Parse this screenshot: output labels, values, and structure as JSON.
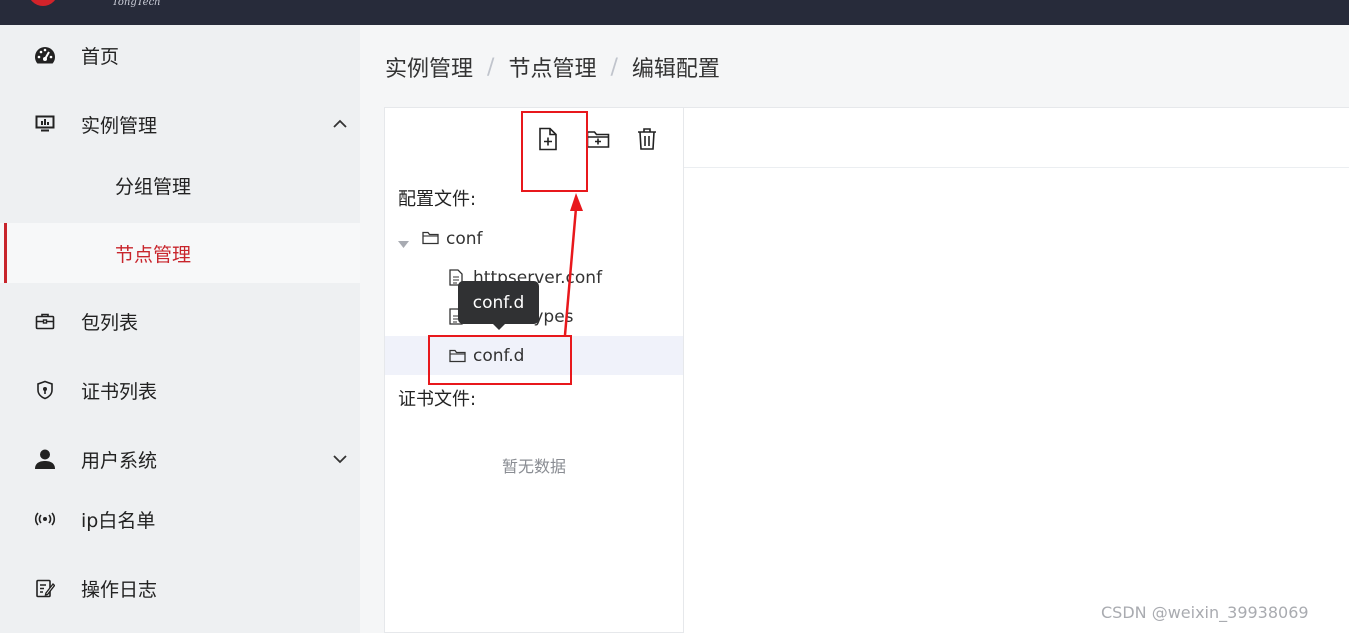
{
  "header": {
    "logo_text": "TongTech",
    "brand_color": "#d2232a"
  },
  "sidebar": {
    "items": [
      {
        "label": "首页",
        "icon": "dashboard-icon"
      },
      {
        "label": "实例管理",
        "icon": "monitor-icon",
        "expanded": true
      },
      {
        "label": "分组管理"
      },
      {
        "label": "节点管理",
        "active": true
      },
      {
        "label": "包列表",
        "icon": "briefcase-icon"
      },
      {
        "label": "证书列表",
        "icon": "shield-icon"
      },
      {
        "label": "用户系统",
        "icon": "user-icon",
        "expanded": false
      },
      {
        "label": "ip白名单",
        "icon": "broadcast-icon"
      },
      {
        "label": "操作日志",
        "icon": "edit-note-icon"
      }
    ],
    "active_color": "#c8252c"
  },
  "breadcrumb": {
    "items": [
      "实例管理",
      "节点管理",
      "编辑配置"
    ],
    "separator": "/"
  },
  "tree": {
    "toolbar": {
      "icons": [
        "new-file-icon",
        "new-folder-icon",
        "trash-icon"
      ]
    },
    "config_title": "配置文件:",
    "nodes": [
      {
        "label": "conf",
        "type": "folder",
        "expanded": true
      },
      {
        "label": "httpserver.conf",
        "type": "file"
      },
      {
        "label": "mime.types",
        "type": "file"
      },
      {
        "label": "conf.d",
        "type": "folder",
        "selected": true
      }
    ],
    "cert_title": "证书文件:",
    "cert_empty": "暂无数据"
  },
  "tooltip": {
    "text": "conf.d"
  },
  "annotation_color": "#e8181c",
  "watermark": "CSDN @weixin_39938069"
}
